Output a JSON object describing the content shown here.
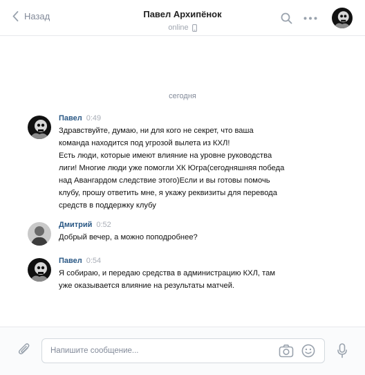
{
  "header": {
    "back_label": "Назад",
    "title": "Павел Архипёнок",
    "status": "online"
  },
  "chat": {
    "date_divider": "сегодня",
    "messages": [
      {
        "author": "Павел",
        "time": "0:49",
        "lines": [
          "Здравствуйте, думаю, ни для кого не секрет, что ваша",
          "команда находится под угрозой вылета из КХЛ!",
          "Есть люди, которые имеют влияние на уровне руководства",
          "лиги! Многие люди уже помогли ХК Югра(сегодняшняя победа",
          "над Авангардом следствие этого)Если и вы готовы помочь",
          "клубу, прошу ответить мне, я укажу реквизиты для перевода",
          "средств в поддержку клубу"
        ]
      },
      {
        "author": "Дмитрий",
        "time": "0:52",
        "lines": [
          "Добрый вечер, а можно поподробнее?"
        ]
      },
      {
        "author": "Павел",
        "time": "0:54",
        "lines": [
          "Я собираю, и передаю средства в администрацию КХЛ, там",
          "уже оказывается влияние на результаты матчей."
        ]
      }
    ]
  },
  "composer": {
    "placeholder": "Напишите сообщение..."
  },
  "icons": {
    "back": "chevron-left-icon",
    "phone": "phone-icon",
    "search": "search-icon",
    "more": "more-icon",
    "attach": "paperclip-icon",
    "camera": "camera-icon",
    "emoji": "smile-icon",
    "mic": "microphone-icon"
  },
  "colors": {
    "link": "#2a5885",
    "muted": "#828a99",
    "divider": "#e7e8ec",
    "icon": "#99a2ad"
  }
}
